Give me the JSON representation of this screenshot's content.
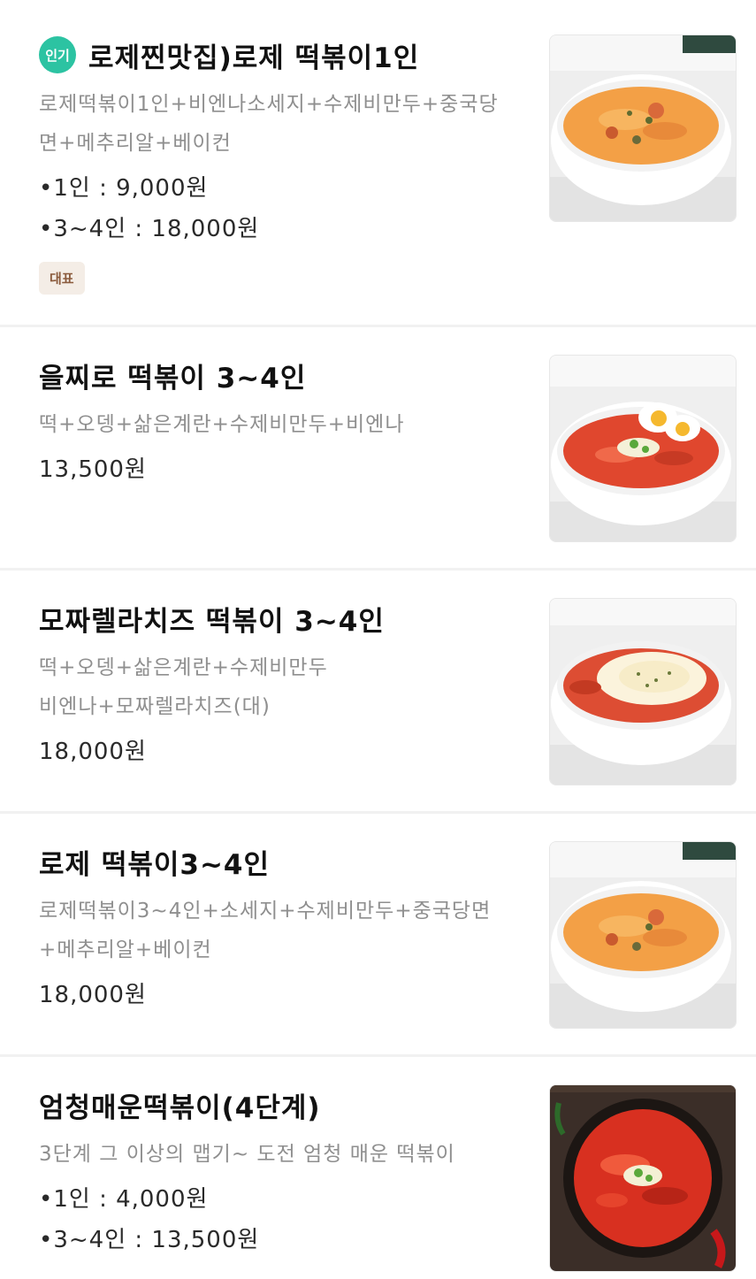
{
  "menu": {
    "items": [
      {
        "popular_badge": "인기",
        "title": "로제찐맛집)로제 떡볶이1인",
        "description": [
          "로제떡볶이1인+비엔나소세지+수제비만두+중국당",
          "면+메추리알+베이컨"
        ],
        "prices": [
          "•1인 : 9,000원",
          "•3~4인 : 18,000원"
        ],
        "tag": "대표",
        "image": "rose-tteokbokki-bowl"
      },
      {
        "title": "을찌로 떡볶이 3~4인",
        "description": [
          "떡+오뎅+삶은계란+수제비만두+비엔나"
        ],
        "prices": [
          "13,500원"
        ],
        "image": "red-tteokbokki-with-eggs"
      },
      {
        "title": "모짜렐라치즈 떡볶이 3~4인",
        "description": [
          "떡+오뎅+삶은계란+수제비만두",
          "비엔나+모짜렐라치즈(대)"
        ],
        "prices": [
          "18,000원"
        ],
        "image": "cheese-tteokbokki-bowl"
      },
      {
        "title": "로제 떡볶이3~4인",
        "description": [
          "로제떡볶이3~4인+소세지+수제비만두+중국당면",
          "+메추리알+베이컨"
        ],
        "prices": [
          "18,000원"
        ],
        "image": "rose-tteokbokki-bowl"
      },
      {
        "title": "엄청매운떡볶이(4단계)",
        "description": [
          "3단계 그 이상의 맵기~ 도전 엄청 매운 떡볶이"
        ],
        "prices": [
          "•1인 : 4,000원",
          "•3~4인 : 13,500원"
        ],
        "image": "spicy-tteokbokki-dark-bowl"
      }
    ]
  },
  "colors": {
    "popular_badge": "#2cc3a2",
    "rep_tag_bg": "#f4ede6",
    "rep_tag_text": "#8a5a3c",
    "description": "#8f8f8f",
    "divider": "#f1f1f1"
  }
}
